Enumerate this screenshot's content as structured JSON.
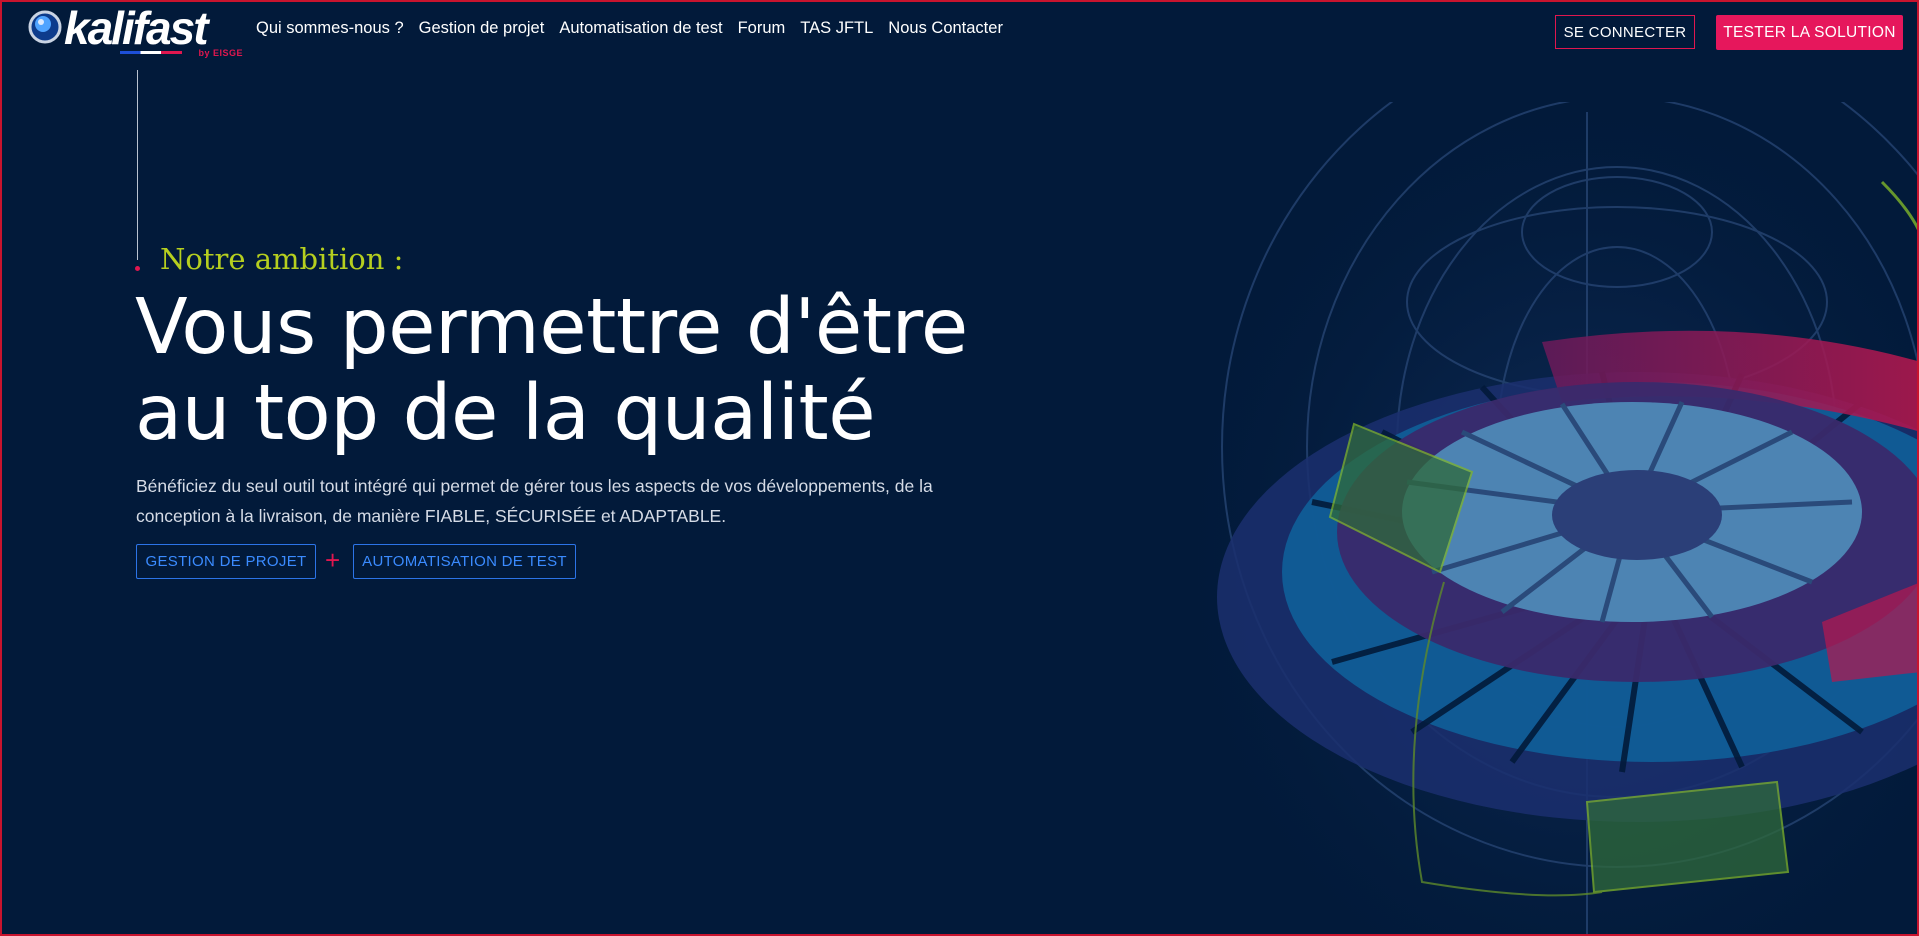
{
  "brand": {
    "logo_text": "kalifast",
    "logo_sub": "by EISGE"
  },
  "nav": {
    "links": [
      "Qui sommes-nous ?",
      "Gestion de projet",
      "Automatisation de test",
      "Forum",
      "TAS JFTL",
      "Nous Contacter"
    ],
    "login_label": "SE CONNECTER",
    "try_label": "TESTER LA SOLUTION"
  },
  "hero": {
    "kicker": "Notre ambition :",
    "headline_line1": "Vous permettre d'être",
    "headline_line2": "au top de la qualité",
    "description": "Bénéficiez du seul outil tout intégré qui permet de gérer tous les aspects de vos développements, de la conception à la livraison, de manière FIABLE, SÉCURISÉE et ADAPTABLE.",
    "button_project": "GESTION DE PROJET",
    "plus_sign": "+",
    "button_automation": "AUTOMATISATION DE TEST"
  },
  "colors": {
    "background": "#021a3a",
    "accent_pink": "#e6175c",
    "accent_lime": "#b6cf1f",
    "accent_blue": "#2c74e8"
  },
  "icons": [
    "globe-logo-icon",
    "wireframe-globe-illustration"
  ]
}
